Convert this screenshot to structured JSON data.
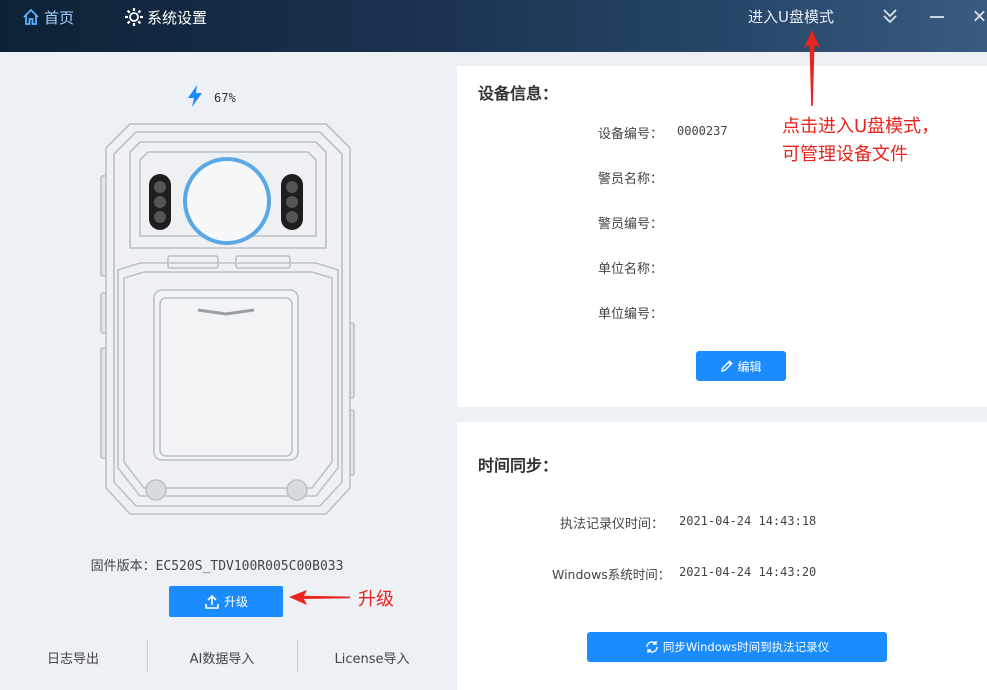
{
  "nav": {
    "home_label": "首页",
    "settings_label": "系统设置",
    "u_mode_label": "进入U盘模式"
  },
  "battery": {
    "percent_text": "67%",
    "level": 0.67
  },
  "firmware": {
    "label": "固件版本：",
    "value": "EC520S_TDV100R005C00B033"
  },
  "upgrade_label": "升级",
  "bottom_links": [
    "日志导出",
    "AI数据导入",
    "License导入"
  ],
  "device_info": {
    "title": "设备信息：",
    "rows": [
      {
        "label": "设备编号：",
        "value": "0000237"
      },
      {
        "label": "警员名称：",
        "value": ""
      },
      {
        "label": "警员编号：",
        "value": ""
      },
      {
        "label": "单位名称：",
        "value": ""
      },
      {
        "label": "单位编号：",
        "value": ""
      }
    ],
    "edit_label": "编辑"
  },
  "time_sync": {
    "title": "时间同步：",
    "rows": [
      {
        "label": "执法记录仪时间：",
        "value": "2021-04-24 14:43:18"
      },
      {
        "label": "Windows系统时间：",
        "value": "2021-04-24 14:43:20"
      }
    ],
    "sync_label": "同步Windows时间到执法记录仪"
  },
  "annotations": {
    "u_mode_note_line1": "点击进入U盘模式，",
    "u_mode_note_line2": "可管理设备文件",
    "upgrade_note": "升级"
  },
  "colors": {
    "accent": "#1a8cff",
    "annotation": "#e8241c",
    "lens_ring": "#5aa9e6"
  }
}
